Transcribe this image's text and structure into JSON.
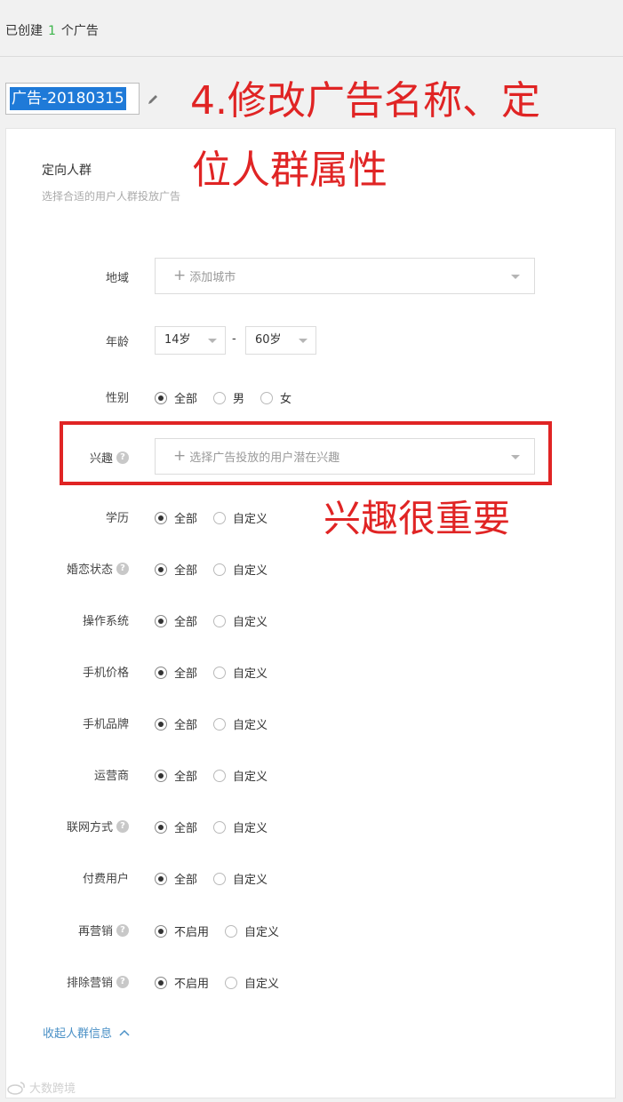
{
  "summary": {
    "prefix": "已创建",
    "count": "1",
    "suffix": "个广告"
  },
  "ad_name": {
    "value": "广告-20180315"
  },
  "annotations": {
    "title_line1": "4.修改广告名称、定",
    "title_line2": "位人群属性",
    "interest_note": "兴趣很重要"
  },
  "section": {
    "title": "定向人群",
    "subtitle": "选择合适的用户人群投放广告"
  },
  "region": {
    "label": "地域",
    "placeholder": "添加城市"
  },
  "age": {
    "label": "年龄",
    "min": "14岁",
    "max": "60岁",
    "separator": "-"
  },
  "gender": {
    "label": "性别",
    "options": [
      "全部",
      "男",
      "女"
    ]
  },
  "interest": {
    "label": "兴趣",
    "placeholder": "选择广告投放的用户潜在兴趣"
  },
  "rows": [
    {
      "label": "学历",
      "options": [
        "全部",
        "自定义"
      ]
    },
    {
      "label": "婚恋状态",
      "options": [
        "全部",
        "自定义"
      ]
    },
    {
      "label": "操作系统",
      "options": [
        "全部",
        "自定义"
      ]
    },
    {
      "label": "手机价格",
      "options": [
        "全部",
        "自定义"
      ]
    },
    {
      "label": "手机品牌",
      "options": [
        "全部",
        "自定义"
      ]
    },
    {
      "label": "运营商",
      "options": [
        "全部",
        "自定义"
      ]
    },
    {
      "label": "联网方式",
      "options": [
        "全部",
        "自定义"
      ]
    },
    {
      "label": "付费用户",
      "options": [
        "全部",
        "自定义"
      ]
    },
    {
      "label": "再营销",
      "options": [
        "不启用",
        "自定义"
      ]
    },
    {
      "label": "排除营销",
      "options": [
        "不启用",
        "自定义"
      ]
    }
  ],
  "help_glyph": "?",
  "collapse": {
    "label": "收起人群信息"
  },
  "watermark": {
    "text": "大数跨境"
  },
  "colors": {
    "accent": "#3bb54a",
    "annotation": "#e02424",
    "selection": "#1f7ad8",
    "link": "#4a90c6"
  }
}
